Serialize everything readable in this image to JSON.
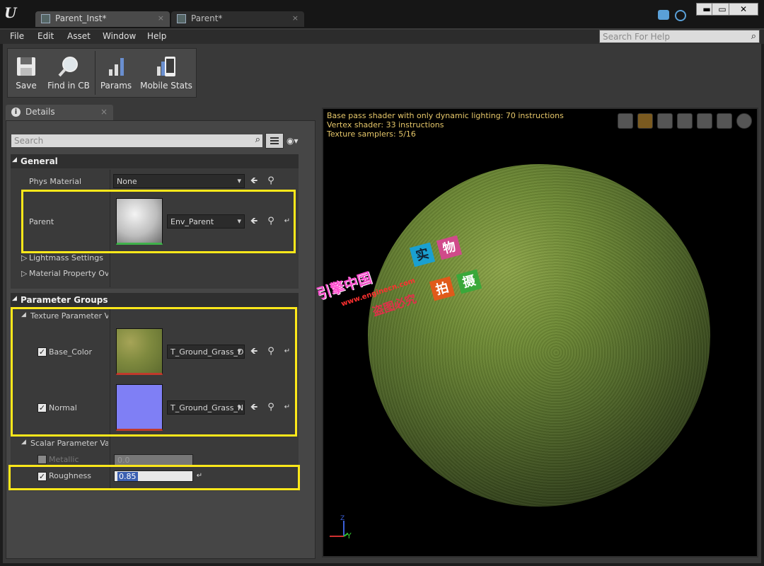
{
  "window": {
    "tabs": [
      {
        "label": "Parent_Inst*",
        "close": "×"
      },
      {
        "label": "Parent*",
        "close": "×"
      }
    ],
    "controls": {
      "minimize": "▬",
      "maximize": "▭",
      "close": "✕"
    }
  },
  "menu": [
    "File",
    "Edit",
    "Asset",
    "Window",
    "Help"
  ],
  "help_search": {
    "placeholder": "Search For Help"
  },
  "toolbar": {
    "save": "Save",
    "find_in_cb": "Find in CB",
    "params": "Params",
    "mobile_stats": "Mobile Stats"
  },
  "details": {
    "tab_label": "Details",
    "search_placeholder": "Search",
    "general": {
      "title": "General",
      "phys_material_label": "Phys Material",
      "phys_material_value": "None",
      "parent_label": "Parent",
      "parent_value": "Env_Parent",
      "lightmass": "Lightmass Settings",
      "material_property": "Material Property Ove"
    },
    "parameter_groups": {
      "title": "Parameter Groups",
      "texture_group": "Texture Parameter Va",
      "base_color_label": "Base_Color",
      "base_color_value": "T_Ground_Grass_D",
      "normal_label": "Normal",
      "normal_value": "T_Ground_Grass_N",
      "scalar_group": "Scalar Parameter Valu",
      "metallic_label": "Metallic",
      "metallic_value": "0.0",
      "roughness_label": "Roughness",
      "roughness_value": "0.85"
    }
  },
  "viewport": {
    "info": [
      "Base pass shader with only dynamic lighting: 70 instructions",
      "Vertex shader: 33 instructions",
      "Texture samplers: 5/16"
    ],
    "axis_z": "Z",
    "axis_y": "Y"
  },
  "watermark": {
    "site_name": "引擎中国",
    "site_url": "www.enginecn.com",
    "tag": "盗图必究",
    "chars": [
      "实",
      "物",
      "拍",
      "摄"
    ]
  },
  "colors": {
    "highlight": "#ffe81a",
    "info_text": "#e6c76a",
    "normal_map": "#7f7ff5",
    "grass": "#6f8b36"
  }
}
